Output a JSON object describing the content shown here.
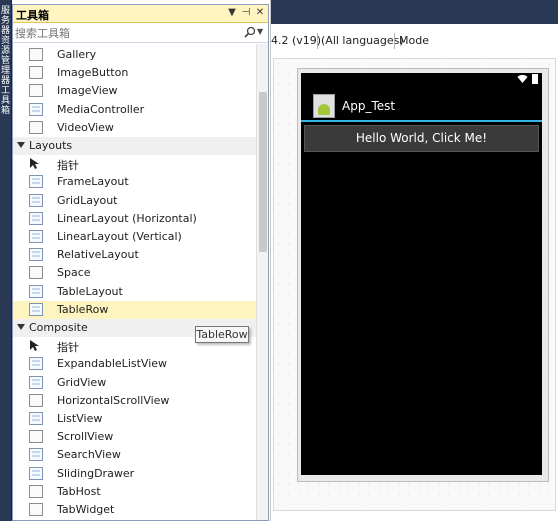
{
  "side_strip": {
    "text": "服务器资源管理器 工具箱"
  },
  "toolbox": {
    "title": "工具箱",
    "controls": {
      "dropdown": "▼",
      "pin": "⊣",
      "close": "✕"
    },
    "search_placeholder": "搜索工具箱",
    "items": [
      {
        "kind": "item",
        "label": "Gallery",
        "icon": "blank-control-icon"
      },
      {
        "kind": "item",
        "label": "ImageButton",
        "icon": "blank-control-icon"
      },
      {
        "kind": "item",
        "label": "ImageView",
        "icon": "blank-control-icon"
      },
      {
        "kind": "item",
        "label": "MediaController",
        "icon": "grid-control-icon"
      },
      {
        "kind": "item",
        "label": "VideoView",
        "icon": "blank-control-icon"
      },
      {
        "kind": "category",
        "label": "Layouts"
      },
      {
        "kind": "item",
        "label": "指针",
        "icon": "pointer-icon"
      },
      {
        "kind": "item",
        "label": "FrameLayout",
        "icon": "grid-control-icon"
      },
      {
        "kind": "item",
        "label": "GridLayout",
        "icon": "grid-control-icon"
      },
      {
        "kind": "item",
        "label": "LinearLayout (Horizontal)",
        "icon": "grid-control-icon"
      },
      {
        "kind": "item",
        "label": "LinearLayout (Vertical)",
        "icon": "grid-control-icon"
      },
      {
        "kind": "item",
        "label": "RelativeLayout",
        "icon": "grid-control-icon"
      },
      {
        "kind": "item",
        "label": "Space",
        "icon": "blank-control-icon"
      },
      {
        "kind": "item",
        "label": "TableLayout",
        "icon": "grid-control-icon"
      },
      {
        "kind": "item",
        "label": "TableRow",
        "icon": "grid-control-icon",
        "selected": true
      },
      {
        "kind": "category",
        "label": "Composite"
      },
      {
        "kind": "item",
        "label": "指针",
        "icon": "pointer-icon"
      },
      {
        "kind": "item",
        "label": "ExpandableListView",
        "icon": "grid-control-icon"
      },
      {
        "kind": "item",
        "label": "GridView",
        "icon": "grid-control-icon"
      },
      {
        "kind": "item",
        "label": "HorizontalScrollView",
        "icon": "blank-control-icon"
      },
      {
        "kind": "item",
        "label": "ListView",
        "icon": "grid-control-icon"
      },
      {
        "kind": "item",
        "label": "ScrollView",
        "icon": "blank-control-icon"
      },
      {
        "kind": "item",
        "label": "SearchView",
        "icon": "grid-control-icon"
      },
      {
        "kind": "item",
        "label": "SlidingDrawer",
        "icon": "grid-control-icon"
      },
      {
        "kind": "item",
        "label": "TabHost",
        "icon": "blank-control-icon"
      },
      {
        "kind": "item",
        "label": "TabWidget",
        "icon": "blank-control-icon"
      }
    ],
    "tooltip": "TableRow"
  },
  "designer": {
    "toolbar": {
      "api_level": "4.2 (v19)",
      "language": "(All languages)",
      "mode": "Mode"
    },
    "device": {
      "app_title": "App_Test",
      "button_label": "Hello World, Click Me!",
      "status_icons": [
        "wifi-icon",
        "battery-icon"
      ]
    }
  },
  "colors": {
    "selection_highlight": "#fdf4bf",
    "ide_chrome": "#293955",
    "holo_blue": "#33b5e5",
    "screen_background": "#000000"
  }
}
